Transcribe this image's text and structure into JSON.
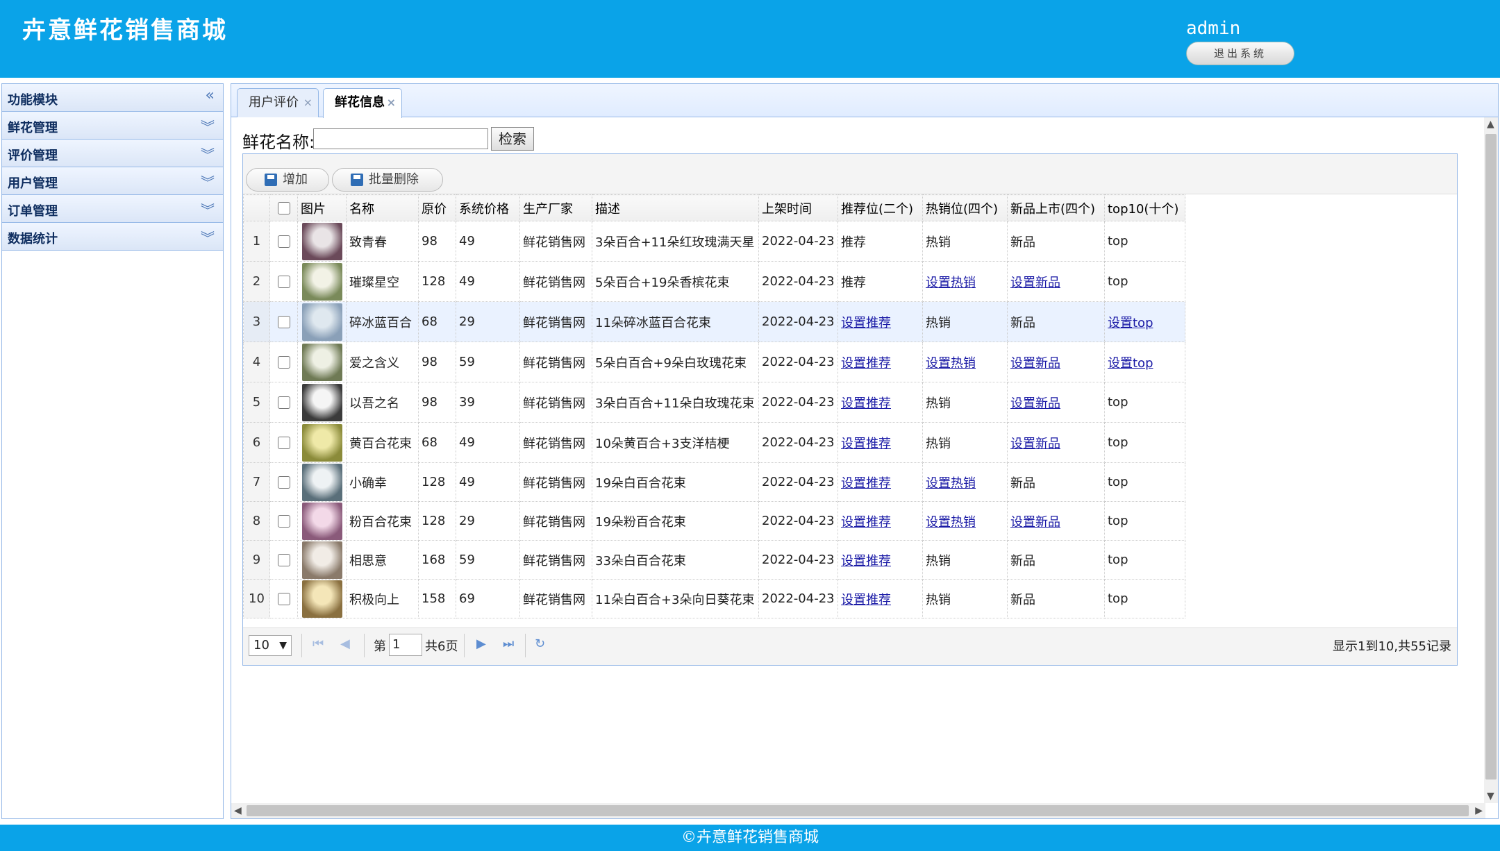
{
  "header": {
    "title": "卉意鲜花销售商城",
    "user": "admin",
    "logout_label": "退出系统"
  },
  "sidebar": {
    "title": "功能模块",
    "items": [
      {
        "label": "鲜花管理"
      },
      {
        "label": "评价管理"
      },
      {
        "label": "用户管理"
      },
      {
        "label": "订单管理"
      },
      {
        "label": "数据统计"
      }
    ]
  },
  "tabs": [
    {
      "label": "用户评价",
      "active": false
    },
    {
      "label": "鲜花信息",
      "active": true
    }
  ],
  "search": {
    "label": "鲜花名称:",
    "value": "",
    "button": "检索"
  },
  "toolbar": {
    "add_label": "增加",
    "batch_delete_label": "批量删除"
  },
  "table": {
    "headers": [
      "图片",
      "名称",
      "原价",
      "系统价格",
      "生产厂家",
      "描述",
      "上架时间",
      "推荐位(二个)",
      "热销位(四个)",
      "新品上市(四个)",
      "top10(十个)"
    ],
    "rows": [
      {
        "n": "1",
        "name": "致青春",
        "price": "98",
        "sys_price": "49",
        "maker": "鲜花销售网",
        "desc": "3朵百合+11朵红玫瑰满天星",
        "date": "2022-04-23",
        "rec": "推荐",
        "hot": "热销",
        "new": "新品",
        "top": "top"
      },
      {
        "n": "2",
        "name": "璀璨星空",
        "price": "128",
        "sys_price": "49",
        "maker": "鲜花销售网",
        "desc": "5朵百合+19朵香槟花束",
        "date": "2022-04-23",
        "rec": "推荐",
        "hot": "设置热销",
        "new": "设置新品",
        "top": "top"
      },
      {
        "n": "3",
        "name": "碎冰蓝百合",
        "price": "68",
        "sys_price": "29",
        "maker": "鲜花销售网",
        "desc": "11朵碎冰蓝百合花束",
        "date": "2022-04-23",
        "rec": "设置推荐",
        "hot": "热销",
        "new": "新品",
        "top": "设置top"
      },
      {
        "n": "4",
        "name": "爱之含义",
        "price": "98",
        "sys_price": "59",
        "maker": "鲜花销售网",
        "desc": "5朵白百合+9朵白玫瑰花束",
        "date": "2022-04-23",
        "rec": "设置推荐",
        "hot": "设置热销",
        "new": "设置新品",
        "top": "设置top"
      },
      {
        "n": "5",
        "name": "以吾之名",
        "price": "98",
        "sys_price": "39",
        "maker": "鲜花销售网",
        "desc": "3朵白百合+11朵白玫瑰花束",
        "date": "2022-04-23",
        "rec": "设置推荐",
        "hot": "热销",
        "new": "设置新品",
        "top": "top"
      },
      {
        "n": "6",
        "name": "黄百合花束",
        "price": "68",
        "sys_price": "49",
        "maker": "鲜花销售网",
        "desc": "10朵黄百合+3支洋桔梗",
        "date": "2022-04-23",
        "rec": "设置推荐",
        "hot": "热销",
        "new": "设置新品",
        "top": "top"
      },
      {
        "n": "7",
        "name": "小确幸",
        "price": "128",
        "sys_price": "49",
        "maker": "鲜花销售网",
        "desc": "19朵白百合花束",
        "date": "2022-04-23",
        "rec": "设置推荐",
        "hot": "设置热销",
        "new": "新品",
        "top": "top"
      },
      {
        "n": "8",
        "name": "粉百合花束",
        "price": "128",
        "sys_price": "29",
        "maker": "鲜花销售网",
        "desc": "19朵粉百合花束",
        "date": "2022-04-23",
        "rec": "设置推荐",
        "hot": "设置热销",
        "new": "设置新品",
        "top": "top"
      },
      {
        "n": "9",
        "name": "相思意",
        "price": "168",
        "sys_price": "59",
        "maker": "鲜花销售网",
        "desc": "33朵白百合花束",
        "date": "2022-04-23",
        "rec": "设置推荐",
        "hot": "热销",
        "new": "新品",
        "top": "top"
      },
      {
        "n": "10",
        "name": "积极向上",
        "price": "158",
        "sys_price": "69",
        "maker": "鲜花销售网",
        "desc": "11朵白百合+3朵向日葵花束",
        "date": "2022-04-23",
        "rec": "设置推荐",
        "hot": "热销",
        "new": "新品",
        "top": "top"
      }
    ]
  },
  "pager": {
    "page_size": "10",
    "page_label": "第",
    "page_num": "1",
    "total_label": "共6页",
    "info": "显示1到10,共55记录"
  },
  "footer": {
    "text": "©卉意鲜花销售商城"
  },
  "colors": {
    "header_bg": "#0aa3e8",
    "link": "#1a1aa6",
    "border": "#95b8e7"
  }
}
